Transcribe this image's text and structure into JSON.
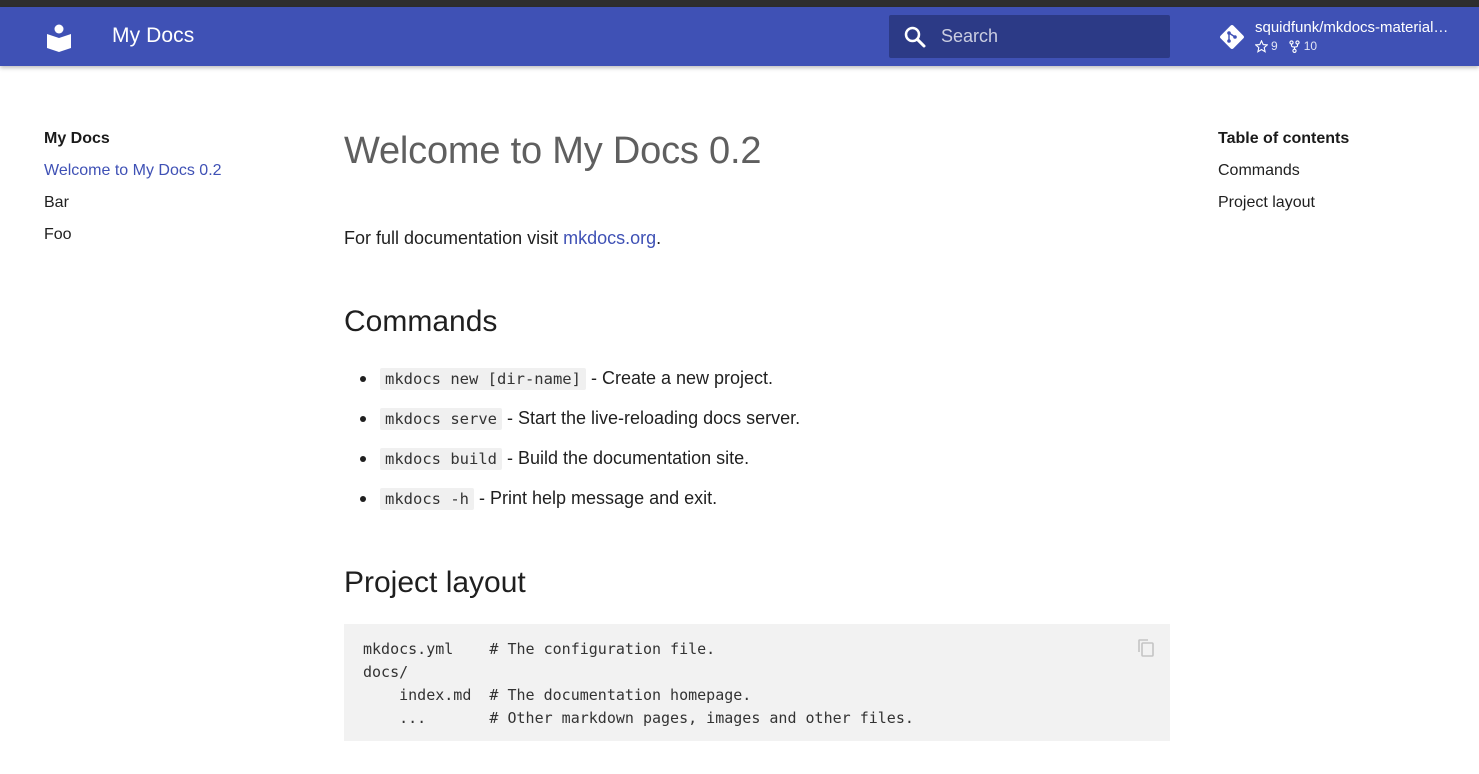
{
  "header": {
    "title": "My Docs",
    "logo_icon": "book-reader-icon",
    "search": {
      "placeholder": "Search",
      "icon": "search-icon"
    },
    "repo": {
      "name": "squidfunk/mkdocs-material…",
      "stars": "9",
      "forks": "10",
      "icon": "git-icon"
    },
    "accent_color": "#3f51b5"
  },
  "nav": {
    "title": "My Docs",
    "items": [
      {
        "label": "Welcome to My Docs 0.2",
        "active": true
      },
      {
        "label": "Bar"
      },
      {
        "label": "Foo"
      }
    ]
  },
  "main": {
    "title": "Welcome to My Docs 0.2",
    "intro_text": "For full documentation visit ",
    "intro_link": "mkdocs.org",
    "intro_end": ".",
    "commands_heading": "Commands",
    "commands": [
      {
        "code": "mkdocs new [dir-name]",
        "text": " - Create a new project."
      },
      {
        "code": "mkdocs serve",
        "text": " - Start the live-reloading docs server."
      },
      {
        "code": "mkdocs build",
        "text": " - Build the documentation site."
      },
      {
        "code": "mkdocs -h",
        "text": " - Print help message and exit."
      }
    ],
    "layout_heading": "Project layout",
    "code_lines": [
      "mkdocs.yml    # The configuration file.",
      "docs/",
      "    index.md  # The documentation homepage.",
      "    ...       # Other markdown pages, images and other files."
    ]
  },
  "toc": {
    "title": "Table of contents",
    "items": [
      "Commands",
      "Project layout"
    ]
  }
}
